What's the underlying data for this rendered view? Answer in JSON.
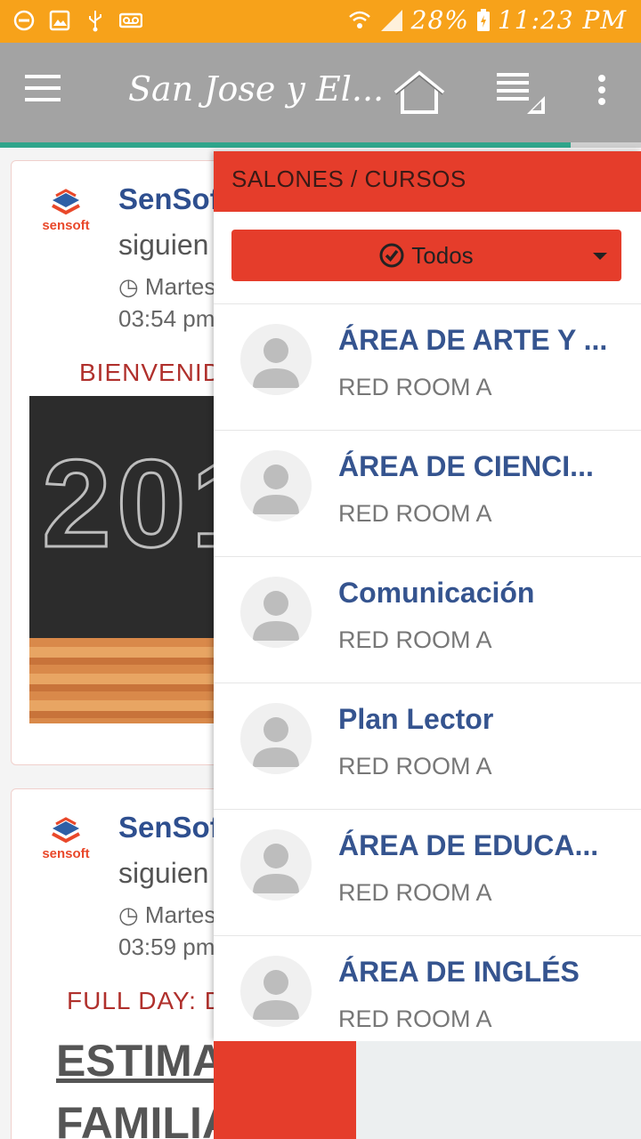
{
  "status_bar": {
    "battery": "28%",
    "time": "11:23 PM",
    "icons": [
      "do-not-disturb-icon",
      "image-icon",
      "usb-icon",
      "voicemail-icon",
      "wifi-icon",
      "signal-icon",
      "battery-charging-icon"
    ]
  },
  "toolbar": {
    "title": "San Jose y El...",
    "progress": 0.89
  },
  "feed": {
    "posts": [
      {
        "logo_text": "sensoft",
        "author": "SenSoft",
        "subtext": "siguien",
        "date": "Martes",
        "time": "03:54 pm",
        "title": "BIENVENID",
        "image_text": "201"
      },
      {
        "logo_text": "sensoft",
        "author": "SenSoft",
        "subtext": "siguien",
        "date": "Martes",
        "time": "03:59 pm",
        "title": "FULL DAY: D",
        "body_line1": "ESTIMA",
        "body_line2": "FAMILIA"
      }
    ]
  },
  "drawer": {
    "header": "SALONES / CURSOS",
    "filter_label": "Todos",
    "items": [
      {
        "name": "ÁREA DE ARTE Y ...",
        "room": "RED ROOM A"
      },
      {
        "name": "ÁREA DE CIENCI...",
        "room": "RED ROOM A"
      },
      {
        "name": "Comunicación",
        "room": "RED ROOM A"
      },
      {
        "name": "Plan Lector",
        "room": "RED ROOM A"
      },
      {
        "name": "ÁREA DE EDUCA...",
        "room": "RED ROOM A"
      },
      {
        "name": "ÁREA DE INGLÉS",
        "room": "RED ROOM A"
      }
    ]
  },
  "colors": {
    "status_bar": "#f7a21a",
    "toolbar": "#a3a3a3",
    "accent_red": "#e53d2b",
    "item_title": "#35548f",
    "progress": "#2fa58b"
  }
}
